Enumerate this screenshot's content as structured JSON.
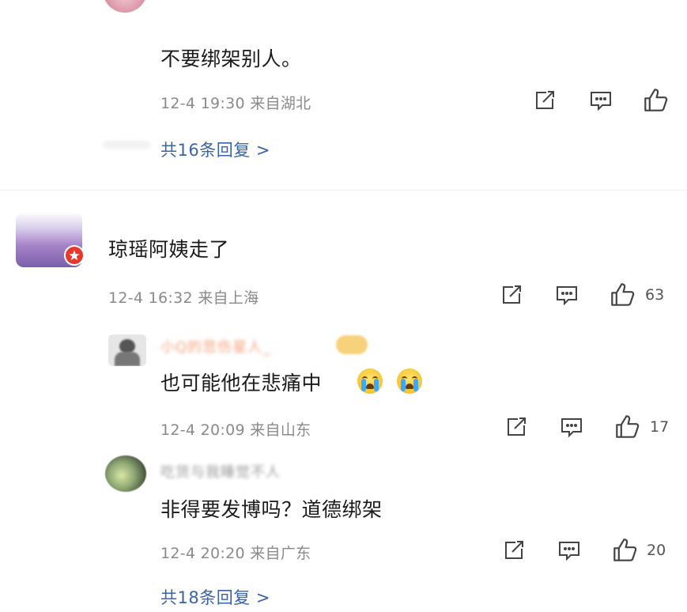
{
  "colors": {
    "reply_link": "#3a64a8",
    "meta_text": "#8a8a8a",
    "badge_red": "#e8372b"
  },
  "comment_top": {
    "text": "不要绑架别人。",
    "meta": "12-4 19:30 来自湖北",
    "replies_link": "共16条回复 >"
  },
  "comment_main": {
    "text": "琼瑶阿姨走了",
    "meta": "12-4 16:32 来自上海",
    "likes": "63"
  },
  "reply_1": {
    "username": "小Q的悲伤星人_",
    "text": "也可能他在悲痛中",
    "emojis": [
      "crying-face",
      "crying-face"
    ],
    "meta": "12-4 20:09 来自山东",
    "likes": "17"
  },
  "reply_2": {
    "username": "吃货与我睡觉不人",
    "text": "非得要发博吗？道德绑架",
    "meta": "12-4 20:20 来自广东",
    "likes": "20"
  },
  "comment_main_replies_link": "共18条回复 >",
  "icons": [
    "share-icon",
    "comment-icon",
    "like-icon"
  ]
}
